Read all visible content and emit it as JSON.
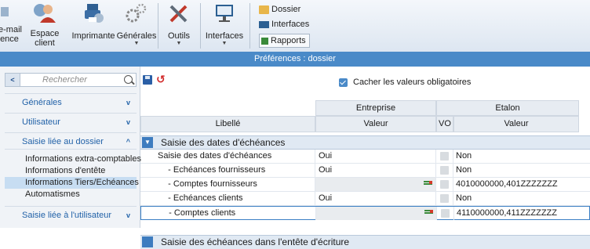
{
  "ribbon": {
    "email_label": "e-mail",
    "ence_label": "ence",
    "espace_client_label": "Espace\nclient",
    "imprimante_label": "Imprimante",
    "generales_label": "Générales",
    "outils_label": "Outils",
    "interfaces_label": "Interfaces",
    "dossier_label": "Dossier",
    "interfaces_small_label": "Interfaces",
    "rapports_label": "Rapports"
  },
  "titlebar": {
    "title": "Préférences : dossier"
  },
  "sidebar": {
    "search_placeholder": "Rechercher",
    "sections": [
      {
        "label": "Générales",
        "chevron": "v"
      },
      {
        "label": "Utilisateur",
        "chevron": "v"
      },
      {
        "label": "Saisie liée au dossier",
        "chevron": "^"
      },
      {
        "label": "Saisie liée à l'utilisateur",
        "chevron": "v"
      }
    ],
    "subitems": [
      "Informations extra-comptables",
      "Informations d'entête",
      "Informations Tiers/Echéances",
      "Automatismes"
    ],
    "selected_subitem": "Informations Tiers/Echéances"
  },
  "main": {
    "checkbox_label": "Cacher les valeurs obligatoires",
    "checkbox_checked": true,
    "header": {
      "entreprise": "Entreprise",
      "etalon": "Etalon",
      "libelle": "Libellé",
      "valeur": "Valeur",
      "vo": "VO",
      "valeur2": "Valeur"
    },
    "group": "Saisie des dates d'échéances",
    "rows": [
      {
        "libelle": "Saisie des dates d'échéances",
        "valeur": "Oui",
        "etalon": "Non"
      },
      {
        "libelle": "   - Echéances fournisseurs",
        "valeur": "Oui",
        "etalon": "Non"
      },
      {
        "libelle": "   - Comptes fournisseurs",
        "valeur": "",
        "etalon": "4010000000,401ZZZZZZZ"
      },
      {
        "libelle": "   - Echéances clients",
        "valeur": "Oui",
        "etalon": "Non"
      },
      {
        "libelle": "   - Comptes clients",
        "valeur": "",
        "etalon": "4110000000,411ZZZZZZZ"
      }
    ],
    "next_group": "Saisie des échéances dans l'entête d'écriture"
  }
}
